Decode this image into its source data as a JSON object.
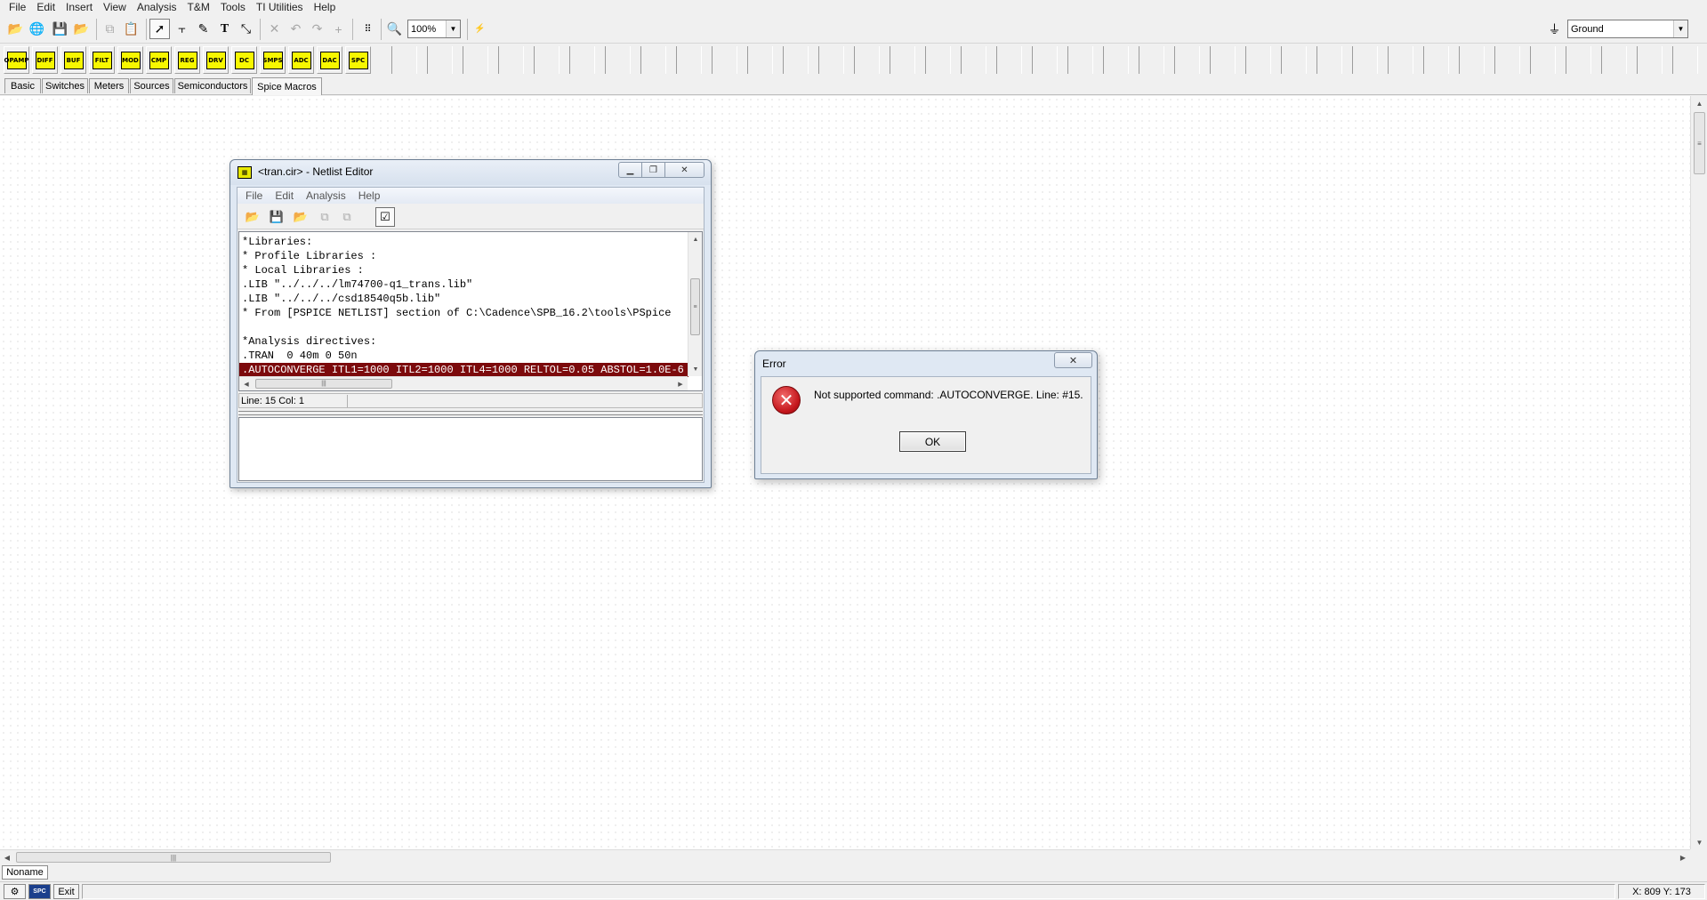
{
  "menu": [
    "File",
    "Edit",
    "Insert",
    "View",
    "Analysis",
    "T&M",
    "Tools",
    "TI Utilities",
    "Help"
  ],
  "toolbar": {
    "zoom_value": "100%",
    "ground_value": "Ground",
    "icons": [
      "open-folder",
      "globe",
      "save",
      "open-file",
      "copy",
      "paste",
      "pointer",
      "wire",
      "pen",
      "text",
      "probe",
      "delete",
      "undo",
      "redo",
      "plus",
      "grid",
      "zoom",
      "ti-logo"
    ]
  },
  "palette": {
    "items": [
      "OPAMP",
      "DIFF",
      "BUF",
      "FILT",
      "MOD",
      "CMP",
      "REG",
      "DRV",
      "DC",
      "SMPS",
      "ADC",
      "DAC",
      "SPC"
    ]
  },
  "palette_tabs": [
    "Basic",
    "Switches",
    "Meters",
    "Sources",
    "Semiconductors",
    "Spice Macros"
  ],
  "netlist_editor": {
    "title": "<tran.cir> - Netlist Editor",
    "menu": [
      "File",
      "Edit",
      "Analysis",
      "Help"
    ],
    "lines": [
      "*Libraries:",
      "* Profile Libraries :",
      "* Local Libraries :",
      ".LIB \"../../../lm74700-q1_trans.lib\"",
      ".LIB \"../../../csd18540q5b.lib\"",
      "* From [PSPICE NETLIST] section of C:\\Cadence\\SPB_16.2\\tools\\PSpice",
      "",
      "*Analysis directives:",
      ".TRAN  0 40m 0 50n",
      ".AUTOCONVERGE ITL1=1000 ITL2=1000 ITL4=1000 RELTOL=0.05 ABSTOL=1.0E-6"
    ],
    "status": "Line: 15 Col: 1"
  },
  "error_dialog": {
    "title": "Error",
    "message": "Not supported command: .AUTOCONVERGE. Line: #15.",
    "ok_label": "OK"
  },
  "document_tab": "Noname",
  "status": {
    "exit_label": "Exit",
    "coords": "X: 809  Y: 173"
  }
}
